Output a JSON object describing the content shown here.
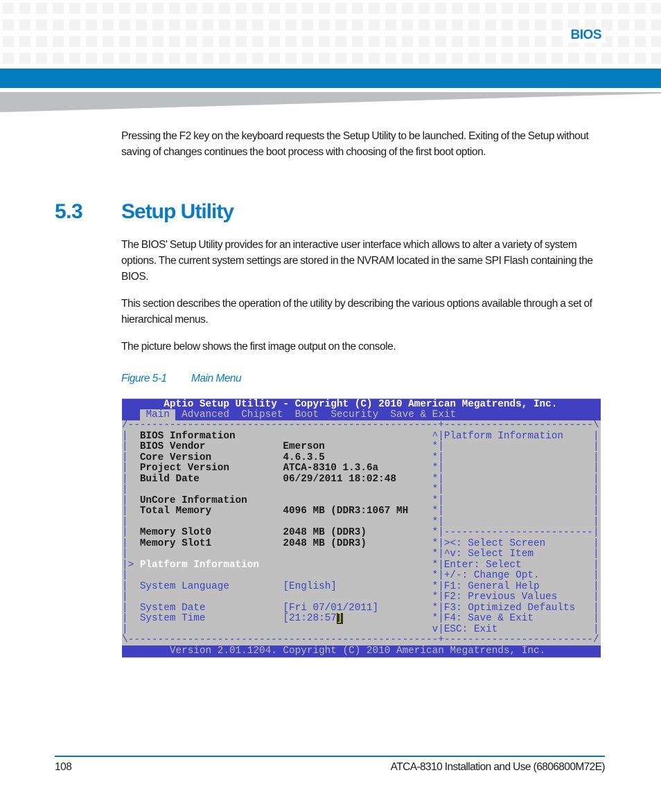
{
  "header": {
    "chapter_label": "BIOS",
    "accent_color": "#037cbd"
  },
  "intro_paragraph": "Pressing the F2 key on the keyboard requests the Setup Utility to be launched. Exiting of the Setup without saving of changes continues the boot process with choosing of the first boot option.",
  "section": {
    "number": "5.3",
    "title": "Setup Utility",
    "paragraphs": [
      "The BIOS' Setup Utility provides for an interactive user interface which allows to alter a variety of system options. The current system settings are stored in the NVRAM located in the same SPI Flash containing the BIOS.",
      "This section describes the operation of the utility by describing the various options available through a set of hierarchical menus.",
      "The picture below shows the first image output on the console."
    ]
  },
  "figure": {
    "label": "Figure 5-1",
    "title": "Main Menu"
  },
  "bios": {
    "title": "Aptio Setup Utility - Copyright (C) 2010 American Megatrends, Inc.",
    "tabs": [
      "Main",
      "Advanced",
      "Chipset",
      "Boot",
      "Security",
      "Save & Exit"
    ],
    "selected_tab": "Main",
    "colors": {
      "bar": "#4040c0",
      "background": "#c0c0c0"
    },
    "left_panel": {
      "bios_info_header": "BIOS Information",
      "bios_vendor_label": "BIOS Vendor",
      "bios_vendor_value": "Emerson",
      "core_version_label": "Core Version",
      "core_version_value": "4.6.3.5",
      "project_version_label": "Project Version",
      "project_version_value": "ATCA-8310 1.3.6a",
      "build_date_label": "Build Date",
      "build_date_value": "06/29/2011 18:02:48",
      "uncore_header": "UnCore Information",
      "total_memory_label": "Total Memory",
      "total_memory_value": "4096 MB (DDR3:1067 MH",
      "slot0_label": "Memory Slot0",
      "slot0_value": "2048 MB (DDR3)",
      "slot1_label": "Memory Slot1",
      "slot1_value": "2048 MB (DDR3)",
      "platform_info_item": "Platform Information",
      "language_label": "System Language",
      "language_value": "[English]",
      "date_label": "System Date",
      "date_value": "[Fri 07/01/2011]",
      "time_label": "System Time",
      "time_value": "[21:28:57",
      "time_cursor": "]"
    },
    "right_panel": {
      "help_title": "Platform Information",
      "keys": [
        "><: Select Screen",
        "^v: Select Item",
        "Enter: Select",
        "+/-: Change Opt.",
        "F1: General Help",
        "F2: Previous Values",
        "F3: Optimized Defaults",
        "F4: Save & Exit",
        "ESC: Exit"
      ]
    },
    "footer": "Version 2.01.1204. Copyright (C) 2010 American Megatrends, Inc."
  },
  "footer": {
    "page_number": "108",
    "document_title": "ATCA-8310 Installation and Use (6806800M72E)"
  }
}
